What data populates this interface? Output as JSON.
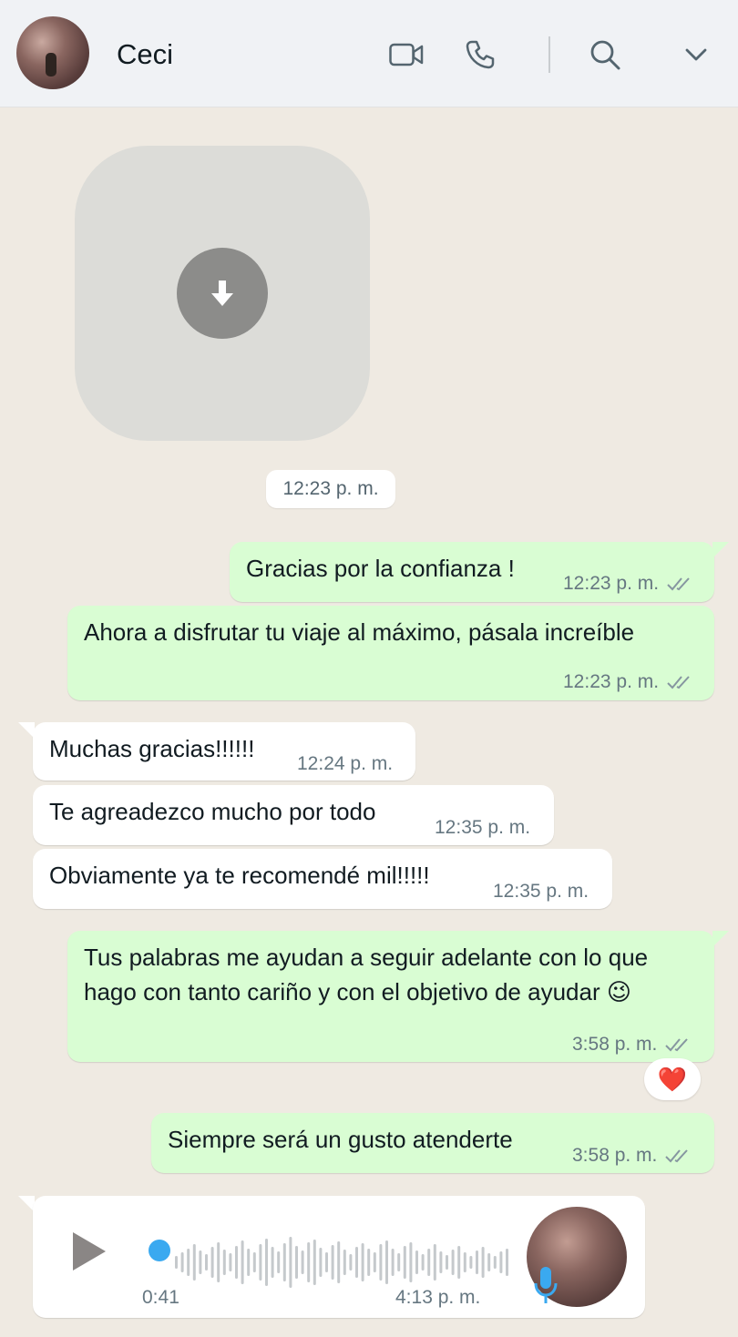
{
  "header": {
    "contact_name": "Ceci",
    "icons": [
      "video-call-icon",
      "voice-call-icon",
      "search-icon",
      "chevron-down-icon"
    ]
  },
  "media": {
    "icon": "download-icon",
    "timestamp": "12:23 p. m."
  },
  "messages": [
    {
      "dir": "out",
      "text": "Gracias por la confianza !",
      "time": "12:23 p. m.",
      "status": "read"
    },
    {
      "dir": "out",
      "text": "Ahora a disfrutar tu viaje al máximo, pásala increíble",
      "time": "12:23 p. m.",
      "status": "read"
    },
    {
      "dir": "in",
      "text": "Muchas gracias!!!!!!",
      "time": "12:24 p. m."
    },
    {
      "dir": "in",
      "text": "Te agreadezco mucho por todo",
      "time": "12:35 p. m."
    },
    {
      "dir": "in",
      "text": "Obviamente ya te recomendé mil!!!!!",
      "time": "12:35 p. m."
    },
    {
      "dir": "out",
      "text": "Tus palabras me ayudan a seguir adelante con lo que hago con tanto cariño y con el objetivo de ayudar 😉",
      "time": "3:58 p. m.",
      "status": "read",
      "reaction": "❤️"
    },
    {
      "dir": "out",
      "text": "Siempre será un gusto atenderte",
      "time": "3:58 p. m.",
      "status": "read"
    }
  ],
  "voice_note": {
    "duration": "0:41",
    "time": "4:13 p. m.",
    "progress": 0.0,
    "icons": [
      "play-icon",
      "microphone-icon"
    ]
  },
  "colors": {
    "outgoing_bubble": "#d9fdd3",
    "incoming_bubble": "#ffffff",
    "background": "#efeae2",
    "read_ticks": "#8696a0",
    "voice_progress": "#3aa9f0"
  }
}
